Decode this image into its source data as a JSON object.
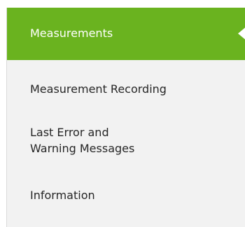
{
  "nav": {
    "items": [
      {
        "label": "Measurements",
        "active": true
      },
      {
        "label": "Measurement Recording",
        "active": false
      },
      {
        "label_line1": "Last Error and",
        "label_line2": "Warning Messages",
        "active": false
      },
      {
        "label": "Information",
        "active": false
      }
    ],
    "accent_color": "#6ab31f",
    "background_color": "#f2f2f2",
    "text_color": "#262626"
  }
}
